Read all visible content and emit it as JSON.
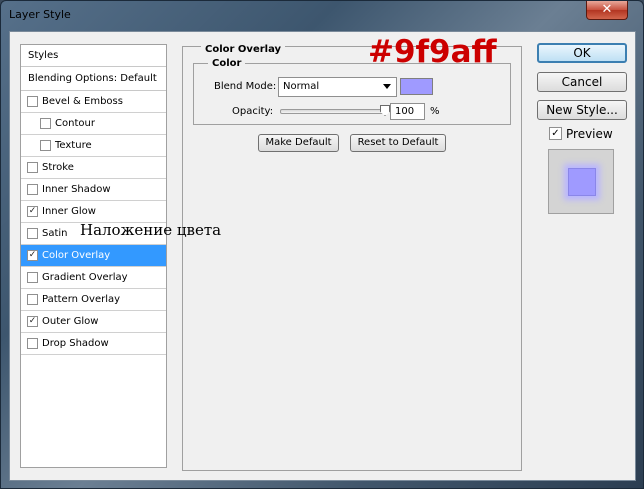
{
  "window": {
    "title": "Layer Style",
    "close_glyph": "✕"
  },
  "styles_panel": {
    "header": "Styles",
    "blending_options": "Blending Options: Default",
    "items": [
      {
        "label": "Bevel & Emboss",
        "checked": false,
        "sub": false
      },
      {
        "label": "Contour",
        "checked": false,
        "sub": true
      },
      {
        "label": "Texture",
        "checked": false,
        "sub": true
      },
      {
        "label": "Stroke",
        "checked": false,
        "sub": false
      },
      {
        "label": "Inner Shadow",
        "checked": false,
        "sub": false
      },
      {
        "label": "Inner Glow",
        "checked": true,
        "sub": false
      },
      {
        "label": "Satin",
        "checked": false,
        "sub": false
      },
      {
        "label": "Color Overlay",
        "checked": true,
        "sub": false,
        "selected": true
      },
      {
        "label": "Gradient Overlay",
        "checked": false,
        "sub": false
      },
      {
        "label": "Pattern Overlay",
        "checked": false,
        "sub": false
      },
      {
        "label": "Outer Glow",
        "checked": true,
        "sub": false
      },
      {
        "label": "Drop Shadow",
        "checked": false,
        "sub": false
      }
    ],
    "check_glyph": "✓"
  },
  "annotations": {
    "russian_label": "Наложение цвета",
    "hex_label": "#9f9aff"
  },
  "color_overlay": {
    "title": "Color Overlay",
    "group_title": "Color",
    "blend_mode_label": "Blend Mode:",
    "blend_mode_value": "Normal",
    "swatch_color": "#9f9aff",
    "opacity_label": "Opacity:",
    "opacity_value": "100",
    "opacity_unit": "%",
    "make_default": "Make Default",
    "reset_default": "Reset to Default"
  },
  "buttons": {
    "ok": "OK",
    "cancel": "Cancel",
    "new_style": "New Style..."
  },
  "preview": {
    "label": "Preview",
    "checked": true,
    "check_glyph": "✓"
  }
}
